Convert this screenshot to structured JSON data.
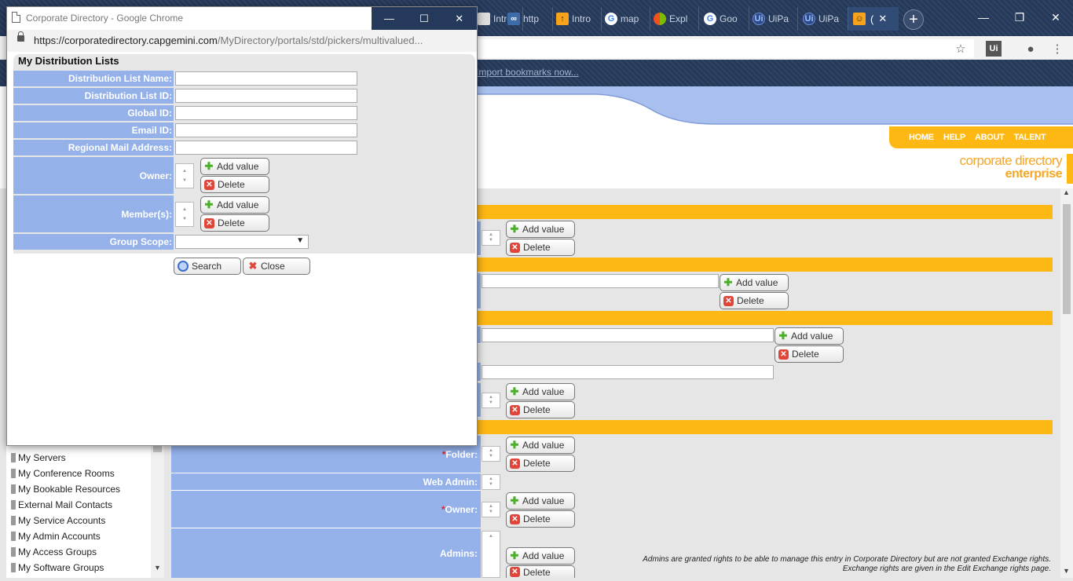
{
  "browser": {
    "tabs": [
      {
        "label": "Intro",
        "icon": "page-icon"
      },
      {
        "label": "http",
        "icon": "link-icon"
      },
      {
        "label": "Intro",
        "icon": "upload-icon"
      },
      {
        "label": "map",
        "icon": "google-icon"
      },
      {
        "label": "Expl",
        "icon": "microsoft-icon"
      },
      {
        "label": "Goo",
        "icon": "google-icon"
      },
      {
        "label": "UiPa",
        "icon": "uipath-icon"
      },
      {
        "label": "UiPa",
        "icon": "uipath-icon"
      }
    ],
    "active_tab_label": "(",
    "new_tab": "+",
    "bookmarks_link": "Import bookmarks now..."
  },
  "page": {
    "nav": [
      "HOME",
      "HELP",
      "ABOUT",
      "TALENT"
    ],
    "brand_line1": "corporate directory",
    "brand_line2": "enterprise",
    "fields": {
      "folder": "Folder:",
      "web_admin": "Web Admin:",
      "owner": "Owner:",
      "admins": "Admins:"
    },
    "add_value": "Add value",
    "delete": "Delete",
    "admins_note_line1": "Admins are granted rights to be able to manage this entry in Corporate Directory but are not granted Exchange rights.",
    "admins_note_line2": "Exchange rights are given in the Edit Exchange rights page.",
    "sidebar_items": [
      "My Servers",
      "My Conference Rooms",
      "My Bookable Resources",
      "External Mail Contacts",
      "My Service Accounts",
      "My Admin Accounts",
      "My Access Groups",
      "My Software Groups"
    ]
  },
  "popup": {
    "window_title": "Corporate Directory - Google Chrome",
    "url_host": "https://corporatedirectory.capgemini.com",
    "url_path": "/MyDirectory/portals/std/pickers/multivalued...",
    "heading": "My Distribution Lists",
    "labels": {
      "dl_name": "Distribution List Name:",
      "dl_id": "Distribution List ID:",
      "global_id": "Global ID:",
      "email_id": "Email ID:",
      "regional_mail": "Regional Mail Address:",
      "owner": "Owner:",
      "members": "Member(s):",
      "group_scope": "Group Scope:"
    },
    "values": {
      "dl_name": "",
      "dl_id": "",
      "global_id": "",
      "email_id": "",
      "regional_mail": "",
      "group_scope": ""
    },
    "add_value": "Add value",
    "delete": "Delete",
    "search": "Search",
    "close": "Close"
  },
  "colors": {
    "label_blue": "#94b1ea",
    "orange": "#fdb813",
    "chrome_dark": "#25395a"
  }
}
